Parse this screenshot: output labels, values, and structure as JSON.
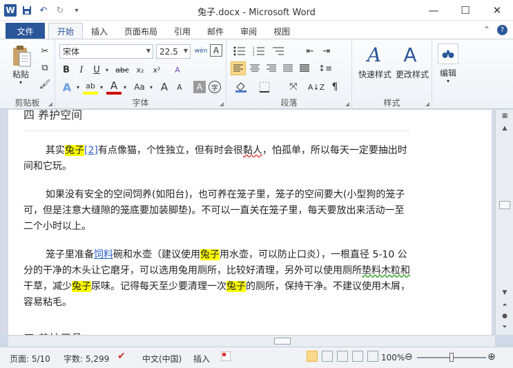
{
  "window": {
    "title": "兔子.docx - Microsoft Word",
    "app_icon": "W",
    "minimize": "—",
    "maximize": "☐",
    "close": "✕"
  },
  "quick_access": {
    "save_icon": "💾",
    "undo_icon": "↶",
    "redo_icon": "↻",
    "more_icon": "▾"
  },
  "tabs": {
    "file": "文件",
    "items": [
      "开始",
      "插入",
      "页面布局",
      "引用",
      "邮件",
      "审阅",
      "视图"
    ],
    "active": "开始",
    "collapse_icon": "⌃",
    "help_icon": "?"
  },
  "ribbon": {
    "clipboard": {
      "label": "剪贴板",
      "paste": "粘贴"
    },
    "font": {
      "label": "字体",
      "font_name": "宋体",
      "font_size": "22.5",
      "wen": "wén",
      "a_box": "A",
      "bold": "B",
      "italic": "I",
      "underline": "U",
      "strike": "abc",
      "subscript": "x₂",
      "superscript": "x²",
      "clear": "A",
      "text_effect": "A",
      "highlight": "ab",
      "font_color": "A",
      "case": "Aa",
      "grow": "A",
      "shrink": "A",
      "shading": "A",
      "enclose": "字"
    },
    "paragraph": {
      "label": "段落"
    },
    "styles": {
      "label": "样式",
      "quick_styles": "快速样式",
      "change_styles": "更改样式"
    },
    "editing": {
      "label": "编辑"
    }
  },
  "document": {
    "top_cut_text": "四  养护空间",
    "bottom_cut_text": "五  养护用具",
    "p1": {
      "a": "其实",
      "hl1": "兔子",
      "ref": "[2]",
      "b": "有点像猫，个性独立，但有时会很",
      "sq": "黏人",
      "c": "，怕孤单，所以每天一定要抽出时间和它玩。"
    },
    "p2": {
      "text": "如果没有安全的空间饲养(如阳台)，也可养在笼子里，笼子的空间要大(小型狗的笼子可，但是注意大缝隙的笼底要加装脚垫)。不可以一直关在笼子里，每天要放出来活动一至二个小时以上。"
    },
    "p3": {
      "a": "笼子里准备",
      "link": "饲料",
      "b": "碗和水壶（建议使用",
      "hl1": "兔子",
      "c": "用水壶，可以防止口炎），一根直径 5-10 公分的干净的木头让它磨牙，可以选用兔用厕所，比较好清理，另外可以使用厕所",
      "gs": "垫料木粒和",
      "d": "干草，减少",
      "hl2": "兔子",
      "e": "尿味。记得每天至少要清理一次",
      "hl3": "兔子",
      "f": "的厕所，保持干净。不建议使用木屑，容易粘毛。"
    }
  },
  "statusbar": {
    "page": "页面: 5/10",
    "words": "字数: 5,299",
    "language": "中文(中国)",
    "mode": "插入",
    "zoom": "100%",
    "zoom_level": 0.5
  }
}
